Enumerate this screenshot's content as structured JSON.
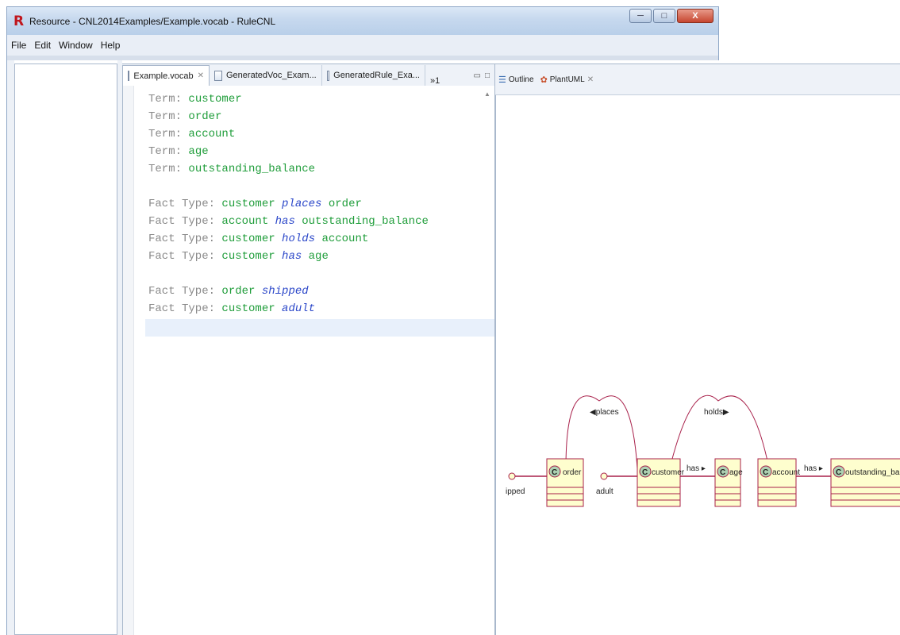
{
  "window": {
    "app_logo": "R",
    "title": "Resource - CNL2014Examples/Example.vocab - RuleCNL",
    "controls": {
      "minimize": "─",
      "maximize": "□",
      "close": "X"
    }
  },
  "menu": [
    "File",
    "Edit",
    "Window",
    "Help"
  ],
  "editor": {
    "tabs": [
      {
        "label": "Example.vocab",
        "close": "✕",
        "active": true
      },
      {
        "label": "GeneratedVoc_Exam...",
        "close": "",
        "active": false
      },
      {
        "label": "GeneratedRule_Exa...",
        "close": "",
        "active": false
      }
    ],
    "overflow": "»1",
    "view_controls": {
      "minimize": "▭",
      "maximize": "□"
    },
    "lines": [
      {
        "kw": "Term: ",
        "parts": [
          {
            "t": "customer",
            "c": "term"
          }
        ]
      },
      {
        "kw": "Term: ",
        "parts": [
          {
            "t": "order",
            "c": "term"
          }
        ]
      },
      {
        "kw": "Term: ",
        "parts": [
          {
            "t": "account",
            "c": "term"
          }
        ]
      },
      {
        "kw": "Term: ",
        "parts": [
          {
            "t": "age",
            "c": "term"
          }
        ]
      },
      {
        "kw": "Term: ",
        "parts": [
          {
            "t": "outstanding_balance",
            "c": "term"
          }
        ]
      },
      {
        "blank": true
      },
      {
        "kw": "Fact Type: ",
        "parts": [
          {
            "t": "customer",
            "c": "term"
          },
          {
            "t": " places ",
            "c": "verb"
          },
          {
            "t": "order",
            "c": "term"
          }
        ]
      },
      {
        "kw": "Fact Type: ",
        "parts": [
          {
            "t": "account",
            "c": "term"
          },
          {
            "t": " has ",
            "c": "verb"
          },
          {
            "t": "outstanding_balance",
            "c": "term"
          }
        ]
      },
      {
        "kw": "Fact Type: ",
        "parts": [
          {
            "t": "customer",
            "c": "term"
          },
          {
            "t": " holds ",
            "c": "verb"
          },
          {
            "t": "account",
            "c": "term"
          }
        ]
      },
      {
        "kw": "Fact Type: ",
        "parts": [
          {
            "t": "customer",
            "c": "term"
          },
          {
            "t": " has ",
            "c": "verb"
          },
          {
            "t": "age",
            "c": "term"
          }
        ]
      },
      {
        "blank": true
      },
      {
        "kw": "Fact Type: ",
        "parts": [
          {
            "t": "order",
            "c": "term"
          },
          {
            "t": " shipped",
            "c": "verb"
          }
        ]
      },
      {
        "kw": "Fact Type: ",
        "parts": [
          {
            "t": "customer",
            "c": "term"
          },
          {
            "t": " adult",
            "c": "verb"
          }
        ]
      }
    ]
  },
  "right_panel": {
    "tabs": [
      {
        "label": "Outline",
        "icon": "outline-icon"
      },
      {
        "label": "PlantUML",
        "icon": "plantuml-icon",
        "close": "✕"
      }
    ],
    "uml": {
      "classes": [
        "order",
        "customer",
        "age",
        "account",
        "outstanding_balance"
      ],
      "class_stereotype": "C",
      "interfaces": [
        {
          "label": "shipped",
          "visible_text": "ipped"
        },
        {
          "label": "adult",
          "visible_text": "adult"
        }
      ],
      "arcs": [
        {
          "label": "◀places"
        },
        {
          "label": "holds▶"
        }
      ],
      "links": [
        {
          "label": "has ▸"
        },
        {
          "label": "has ▸"
        }
      ]
    }
  },
  "colors": {
    "term": "#1f9d3a",
    "keyword": "#8a8a8a",
    "verb": "#2b47c9",
    "uml_line": "#a8204a",
    "uml_class_fill": "#fefece",
    "uml_stereo_fill": "#add1b2"
  }
}
